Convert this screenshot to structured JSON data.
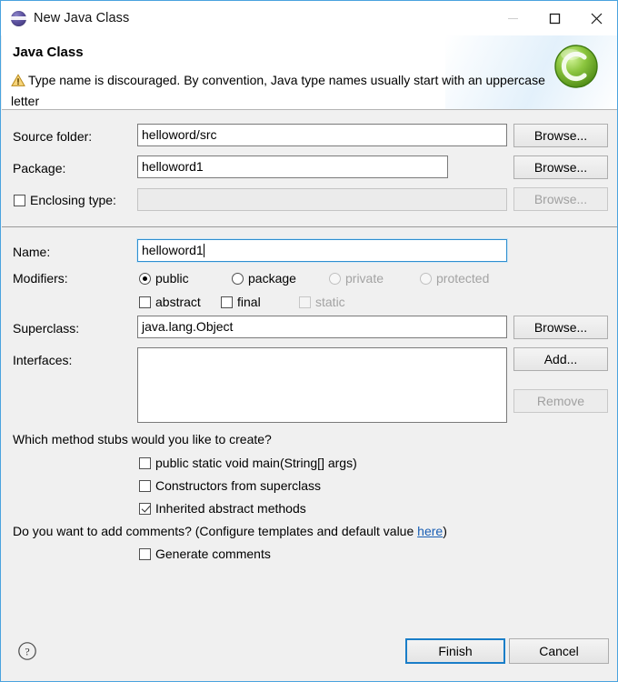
{
  "window": {
    "title": "New Java Class",
    "icon": "java-class-icon",
    "controls": {
      "minimize": "—",
      "maximize": "□",
      "close": "✕"
    }
  },
  "header": {
    "title": "Java Class",
    "message": "Type name is discouraged. By convention, Java type names usually start with an uppercase letter",
    "warning_icon": "warning-triangle-icon",
    "logo": "java-class-wizard-logo",
    "warning_color": "#f0b429"
  },
  "form": {
    "source_folder": {
      "label": "Source folder:",
      "value": "helloword/src",
      "browse": "Browse...",
      "browse_enabled": true
    },
    "package": {
      "label": "Package:",
      "value": "helloword1",
      "browse": "Browse...",
      "browse_enabled": true
    },
    "enclosing_type": {
      "label": "Enclosing type:",
      "value": "",
      "checked": false,
      "browse": "Browse...",
      "browse_enabled": false
    },
    "name": {
      "label": "Name:",
      "value": "helloword1",
      "focused": true
    },
    "modifiers": {
      "label": "Modifiers:",
      "access": [
        {
          "label": "public",
          "selected": true,
          "enabled": true
        },
        {
          "label": "package",
          "selected": false,
          "enabled": true
        },
        {
          "label": "private",
          "selected": false,
          "enabled": false
        },
        {
          "label": "protected",
          "selected": false,
          "enabled": false
        }
      ],
      "flags": [
        {
          "label": "abstract",
          "checked": false,
          "enabled": true
        },
        {
          "label": "final",
          "checked": false,
          "enabled": true
        },
        {
          "label": "static",
          "checked": false,
          "enabled": false
        }
      ]
    },
    "superclass": {
      "label": "Superclass:",
      "value": "java.lang.Object",
      "browse": "Browse...",
      "browse_enabled": true
    },
    "interfaces": {
      "label": "Interfaces:",
      "items": [],
      "add": "Add...",
      "remove": "Remove",
      "add_enabled": true,
      "remove_enabled": false
    }
  },
  "stubs": {
    "question": "Which method stubs would you like to create?",
    "options": [
      {
        "label": "public static void main(String[] args)",
        "checked": false
      },
      {
        "label": "Constructors from superclass",
        "checked": false
      },
      {
        "label": "Inherited abstract methods",
        "checked": true
      }
    ]
  },
  "comments": {
    "question_prefix": "Do you want to add comments? (Configure templates and default value ",
    "link": "here",
    "question_suffix": ")",
    "option": {
      "label": "Generate comments",
      "checked": false
    }
  },
  "footer": {
    "help": "?",
    "finish": "Finish",
    "cancel": "Cancel",
    "default_button": "Finish",
    "accent_color": "#1a7ec8"
  }
}
